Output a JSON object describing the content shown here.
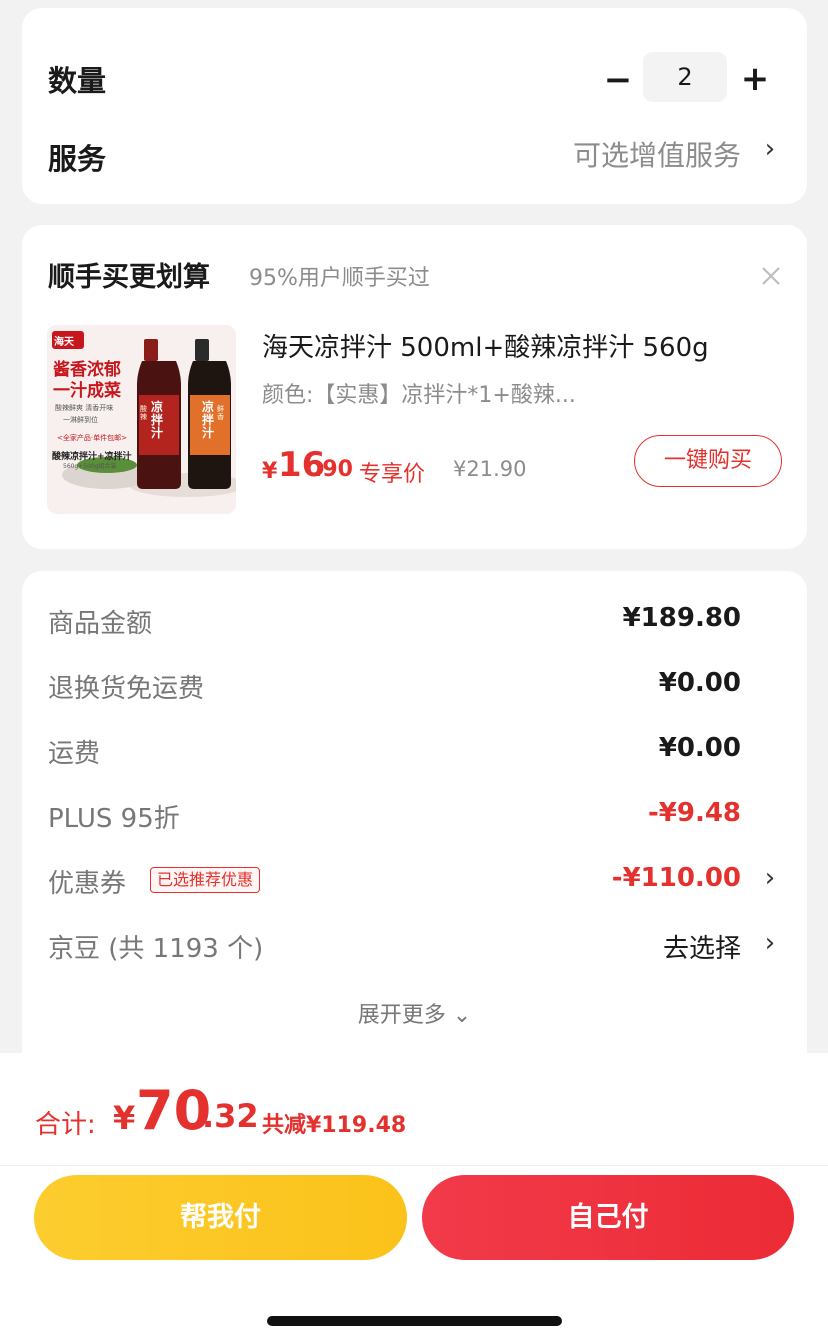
{
  "quantity": {
    "label": "数量",
    "minus": "−",
    "value": "2",
    "plus": "+"
  },
  "service": {
    "label": "服务",
    "value": "可选增值服务",
    "chevron": "›"
  },
  "recommend": {
    "title": "顺手买更划算",
    "subtitle": "95%用户顺手买过",
    "close_icon": "close-icon",
    "product": {
      "name": "海天凉拌汁 500ml+酸辣凉拌汁 560g",
      "spec": "颜色:【实惠】凉拌汁*1+酸辣...",
      "price_yen": "¥",
      "price_int": "16",
      "price_dec": ".90",
      "price_tag": "专享价",
      "original_price": "¥21.90",
      "buy_label": "一键购买",
      "image_text": {
        "brand": "海天",
        "slogan1": "酱香浓郁",
        "slogan2": "一汁成菜",
        "feat1": "酸辣鲜爽 清香开味",
        "feat2": "一淋鲜到位",
        "bottle1": "凉拌汁",
        "bottle2": "凉拌汁",
        "bottle1_tag": "酸辣",
        "bottle2_tag": "鲜香",
        "promo": "<全家产品·单件包邮>",
        "combo": "酸辣凉拌汁+凉拌汁",
        "combo_sub": "560g+500g组合装"
      }
    }
  },
  "price_detail": {
    "rows": [
      {
        "label": "商品金额",
        "value": "¥189.80"
      },
      {
        "label": "退换货免运费",
        "value": "¥0.00"
      },
      {
        "label": "运费",
        "value": "¥0.00"
      },
      {
        "label": "PLUS 95折",
        "value": "-¥9.48"
      },
      {
        "label": "优惠券",
        "badge": "已选推荐优惠",
        "value": "-¥110.00"
      },
      {
        "label": "京豆 (共 1193 个)",
        "value": "去选择"
      }
    ],
    "expand_label": "展开更多 ⌄"
  },
  "footer": {
    "total_label": "合计:",
    "total_yen": "¥",
    "total_int": "70",
    "total_dec": ".32",
    "total_saved": "共减¥119.48",
    "btn_help": "帮我付",
    "btn_self": "自己付"
  },
  "colors": {
    "accent_red": "#e4312d",
    "button_yellow": "#fbc21a",
    "button_red": "#ec2b35",
    "background": "#f2f2f2"
  }
}
